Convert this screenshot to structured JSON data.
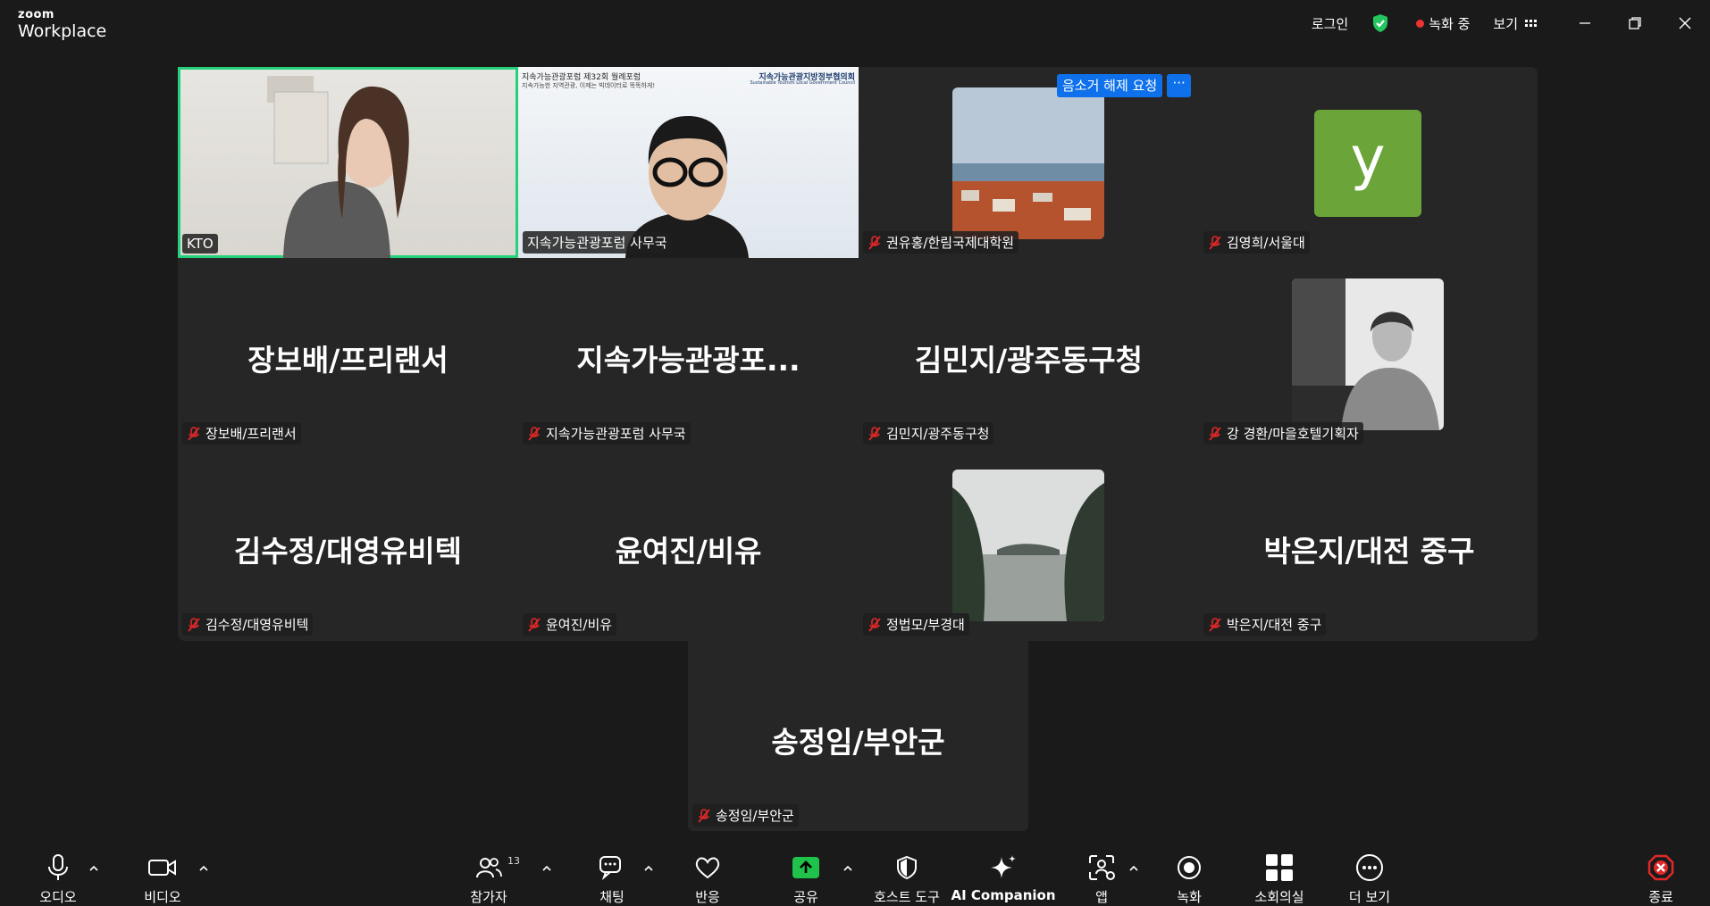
{
  "titlebar": {
    "brand_small": "zoom",
    "brand_large": "Workplace",
    "login": "로그인",
    "recording": "녹화 중",
    "view": "보기"
  },
  "gallery": {
    "unmute_request": "음소거 해제 요청",
    "more": "···",
    "tiles": [
      {
        "name": "KTO",
        "big": ""
      },
      {
        "name": "지속가능관광포럼 사무국",
        "big": ""
      },
      {
        "name": "권유홍/한림국제대학원",
        "big": ""
      },
      {
        "name": "김영희/서울대",
        "big": ""
      },
      {
        "name": "장보배/프리랜서",
        "big": "장보배/프리랜서"
      },
      {
        "name": "지속가능관광포럼 사무국",
        "big": "지속가능관광포..."
      },
      {
        "name": "김민지/광주동구청",
        "big": "김민지/광주동구청"
      },
      {
        "name": "강 경환/마을호텔기획자",
        "big": ""
      },
      {
        "name": "김수정/대영유비텍",
        "big": "김수정/대영유비텍"
      },
      {
        "name": "윤여진/비유",
        "big": "윤여진/비유"
      },
      {
        "name": "정법모/부경대",
        "big": ""
      },
      {
        "name": "박은지/대전 중구",
        "big": "박은지/대전 중구"
      },
      {
        "name": "송정임/부안군",
        "big": "송정임/부안군"
      }
    ],
    "avatar_letter": "y",
    "slide_title": "지속가능관광포럼 제32회 월례포럼",
    "slide_sub": "지속가능한 지역관광, 이제는 빅데이터로 똑똑하게!",
    "slide_org": "지속가능관광지방정부협의회",
    "slide_org_en": "Sustainable Tourism Local Government Council"
  },
  "toolbar": {
    "audio": "오디오",
    "video": "비디오",
    "participants": "참가자",
    "participants_count": "13",
    "chat": "채팅",
    "reactions": "반응",
    "share": "공유",
    "host_tools": "호스트 도구",
    "ai_companion": "AI Companion",
    "apps": "앱",
    "record": "녹화",
    "breakout": "소회의실",
    "more": "더 보기",
    "end": "종료"
  },
  "colors": {
    "active_speaker": "#25d07a",
    "share_green": "#1fc24a",
    "end_red": "#e02828",
    "blue": "#0e71eb"
  }
}
